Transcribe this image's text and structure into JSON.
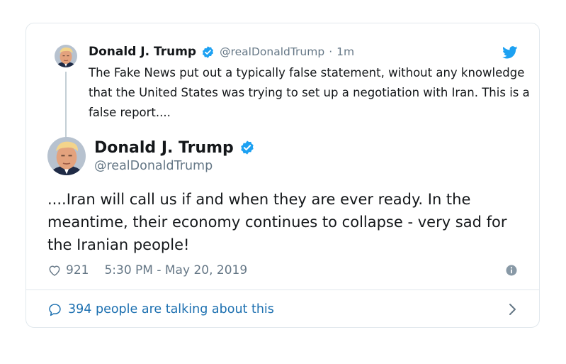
{
  "parent_tweet": {
    "name": "Donald J. Trump",
    "handle": "@realDonaldTrump",
    "separator": "·",
    "time": "1m",
    "text": "The Fake News put out a typically false statement, without any knowledge that the United States was trying to set up a negotiation with Iran. This is a false report...."
  },
  "main_tweet": {
    "name": "Donald J. Trump",
    "handle": "@realDonaldTrump",
    "text": "....Iran will call us if and when they are ever ready. In the meantime, their economy continues to collapse - very sad for the Iranian people!",
    "likes": "921",
    "timestamp": "5:30 PM - May 20, 2019"
  },
  "footer": {
    "talking_label": "394 people are talking about this"
  },
  "icons": {
    "brand": "twitter-bird-icon",
    "verified": "verified-badge-icon",
    "like": "heart-icon",
    "info": "info-icon",
    "reply": "reply-bubble-icon",
    "chevron": "chevron-right-icon"
  },
  "colors": {
    "twitter_blue": "#1da1f2",
    "link_blue": "#1b6fb0",
    "secondary_text": "#657786",
    "border": "#e1e8ed"
  }
}
